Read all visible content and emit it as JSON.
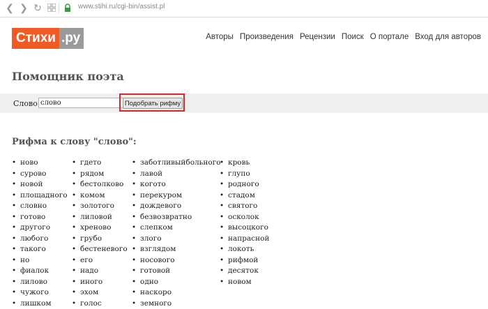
{
  "browser": {
    "url": "www.stihi.ru/cgi-bin/assist.pl"
  },
  "logo": {
    "part1": "Стихи",
    "part2": ".ру"
  },
  "nav": [
    "Авторы",
    "Произведения",
    "Рецензии",
    "Поиск",
    "О портале",
    "Вход для авторов"
  ],
  "page_title": "Помощник поэта",
  "form": {
    "label": "Слово:",
    "value": "слово",
    "button": "Подобрать рифму"
  },
  "result_title": "Рифма к слову \"слово\":",
  "columns": [
    [
      "ново",
      "сурово",
      "новой",
      "площадного",
      "словно",
      "готово",
      "другого",
      "любого",
      "такого",
      "но",
      "фиалок",
      "лилово",
      "чужого",
      "лишком"
    ],
    [
      "гдето",
      "рядом",
      "бестолково",
      "комом",
      "золотого",
      "лиловой",
      "хреново",
      "грубо",
      "бестеневого",
      "его",
      "надо",
      "иного",
      "эхом",
      "голос"
    ],
    [
      "заботливыйбольного",
      "лавой",
      "когото",
      "перекуром",
      "дождевого",
      "безвозвратно",
      "слепком",
      "злого",
      "взглядом",
      "носового",
      "готовой",
      "одно",
      "наскоро",
      "земного"
    ],
    [
      "кровь",
      "глупо",
      "родного",
      "стадом",
      "святого",
      "осколок",
      "высоцкого",
      "напрасной",
      "локоть",
      "рифмой",
      "десяток",
      "новом"
    ]
  ]
}
